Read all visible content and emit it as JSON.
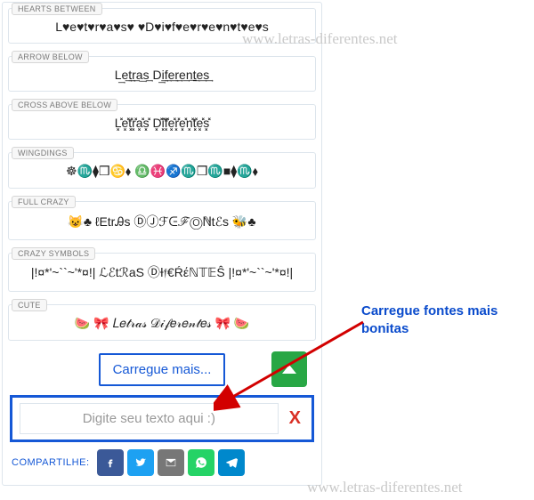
{
  "watermark": "www.letras-diferentes.net",
  "callout": "Carregue fontes mais bonitas",
  "styles": [
    {
      "tag": "HEARTS BETWEEN",
      "text": "L♥e♥t♥r♥a♥s♥ ♥D♥i♥f♥e♥r♥e♥n♥t♥e♥s"
    },
    {
      "tag": "ARROW BELOW",
      "text": "L͢e͢t͢r͢a͢s͢ D͢i͢f͢e͢r͢e͢n͢t͢e͢s͢"
    },
    {
      "tag": "CROSS ABOVE BELOW",
      "text": "L͓̽e͓̽t͓̽r͓̽a͓̽s͓̽ D͓̽i͓̽f͓̽e͓̽r͓̽e͓̽n͓̽t͓̽e͓̽s͓̽"
    },
    {
      "tag": "WINGDINGS",
      "text": "☸♏⧫❒♋⬧ ♎♓♐♏❒♏■⧫♏⬧"
    },
    {
      "tag": "FULL CRAZY",
      "text": "😺♣ ℓEtrᎯs ⒹⒿℱᕮℱⓄℕtℰs 🐝♣"
    },
    {
      "tag": "CRAZY SYMBOLS",
      "text": "|!¤*'~``~'*¤!| ℒℰtℛaS ⒹƗ𝔣€Ŕέℕ𝕋𝔼Ŝ |!¤*'~``~'*¤!|"
    },
    {
      "tag": "CUTE",
      "text": "🍉 🎀 𝐿𝑒𝓉𝓇𝒶𝓈 𝒟𝒾𝒻𝑒𝓇𝑒𝓃𝓉𝑒𝓈 🎀 🍉"
    }
  ],
  "load_more": "Carregue mais...",
  "input_placeholder": "Digite seu texto aqui :)",
  "clear_symbol": "X",
  "share_label": "COMPARTILHE:",
  "share_buttons": [
    {
      "name": "facebook",
      "class": "fb"
    },
    {
      "name": "twitter",
      "class": "tw"
    },
    {
      "name": "email",
      "class": "em"
    },
    {
      "name": "whatsapp",
      "class": "wa"
    },
    {
      "name": "telegram",
      "class": "tg"
    }
  ]
}
